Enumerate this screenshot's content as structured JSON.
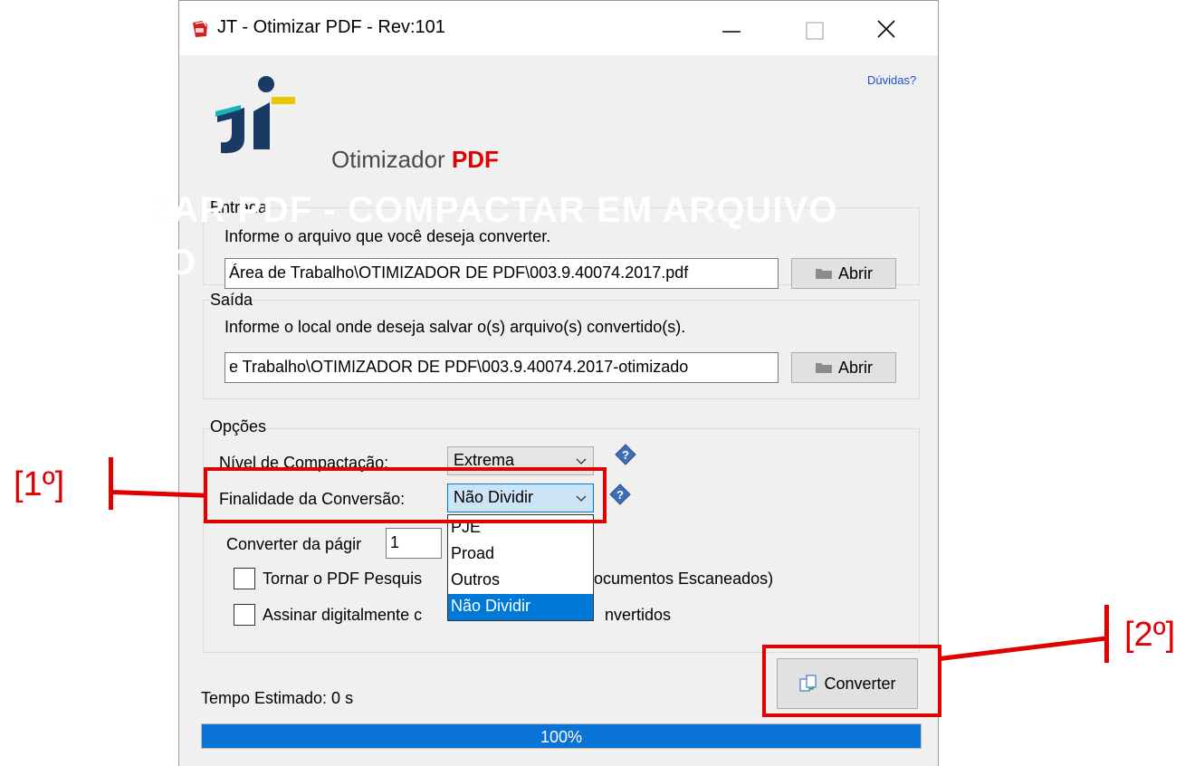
{
  "window": {
    "title": "JT - Otimizar PDF - Rev:101",
    "help_link": "Dúvidas?",
    "brand_prefix": "Otimizador",
    "brand_suffix": "PDF"
  },
  "overlay": {
    "heading_line1": "ZAR PDF - COMPACTAR EM ARQUIVO",
    "heading_line2": "O"
  },
  "entrada": {
    "legend": "Entrada",
    "hint": "Informe o arquivo que você deseja converter.",
    "path": "Área de Trabalho\\OTIMIZADOR DE PDF\\003.9.40074.2017.pdf",
    "open_label": "Abrir"
  },
  "saida": {
    "legend": "Saída",
    "hint": "Informe o local onde deseja salvar o(s) arquivo(s) convertido(s).",
    "path": "e Trabalho\\OTIMIZADOR DE PDF\\003.9.40074.2017-otimizado",
    "open_label": "Abrir"
  },
  "opcoes": {
    "legend": "Opções",
    "nivel_label": "Nível de Compactação:",
    "nivel_value": "Extrema",
    "finalidade_label": "Finalidade da Conversão:",
    "finalidade_value": "Não Dividir",
    "converter_label": "Converter da págir",
    "converter_value": "1",
    "pesquisavel_pre": "Tornar o PDF Pesquis",
    "pesquisavel_post": "ocumentos Escaneados)",
    "assinar_pre": "Assinar digitalmente c",
    "assinar_post": "nvertidos",
    "dropdown_options": [
      "PJE",
      "Proad",
      "Outros",
      "Não Dividir"
    ]
  },
  "footer": {
    "convert_label": "Converter",
    "time_label": "Tempo Estimado:  0 s",
    "progress": 1.0,
    "progress_text": "100%"
  },
  "annotations": {
    "step1": "[1º]",
    "step2": "[2º]"
  },
  "colors": {
    "accent": "#0a74d6",
    "annotation": "#e00000",
    "brand_red": "#e00000",
    "link": "#1a4fd1"
  }
}
